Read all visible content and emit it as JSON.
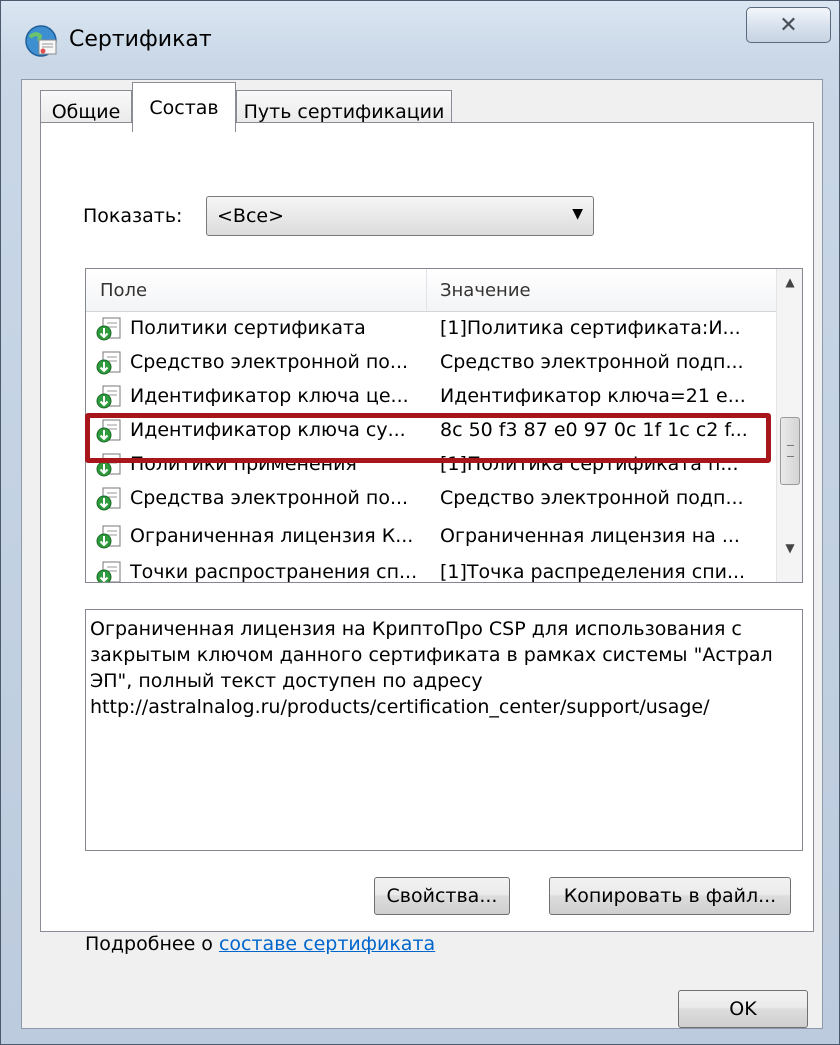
{
  "window": {
    "title": "Сертификат"
  },
  "tabs": [
    {
      "label": "Общие"
    },
    {
      "label": "Состав"
    },
    {
      "label": "Путь сертификации"
    }
  ],
  "show": {
    "label": "Показать:",
    "selected": "<Все>"
  },
  "list": {
    "headers": {
      "field": "Поле",
      "value": "Значение"
    },
    "rows": [
      {
        "field": "Политики сертификата",
        "value": "[1]Политика сертификата:И..."
      },
      {
        "field": "Средство электронной по...",
        "value": "Средство электронной подп..."
      },
      {
        "field": "Идентификатор ключа це...",
        "value": "Идентификатор ключа=21 e..."
      },
      {
        "field": "Идентификатор ключа су...",
        "value": "8c 50 f3 87 e0 97 0c 1f 1c c2 f..."
      },
      {
        "field": "Политики применения",
        "value": "[1]Политика сертификата п..."
      },
      {
        "field": "Средства электронной по...",
        "value": "Средство электронной подп..."
      },
      {
        "field": "Ограниченная лицензия К...",
        "value": "Ограниченная лицензия на ..."
      },
      {
        "field": "Точки распространения сп...",
        "value": "[1]Точка распределения спи..."
      }
    ]
  },
  "detail_text": "Ограниченная лицензия на КриптоПро CSP для использования с закрытым ключом данного сертификата в рамках системы \"Астрал ЭП\", полный текст доступен по адресу http://astralnalog.ru/products/certification_center/support/usage/",
  "buttons": {
    "properties": "Свойства...",
    "copy": "Копировать в файл...",
    "ok": "OK"
  },
  "more_info": {
    "prefix": "Подробнее о ",
    "link": "составе сертификата"
  },
  "colors": {
    "highlight": "#a6161a",
    "link": "#0066cc"
  },
  "icons": {
    "app": "certificate-icon",
    "row": "certificate-field-icon",
    "close": "close-icon"
  }
}
